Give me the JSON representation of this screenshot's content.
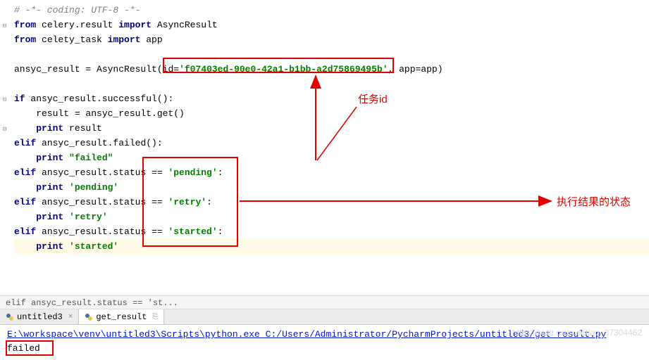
{
  "code": {
    "l1_comment": "# -*- coding: UTF-8 -*-",
    "l2_from": "from",
    "l2_mod": " celery.result ",
    "l2_import": "import",
    "l2_name": " AsyncResult",
    "l3_from": "from",
    "l3_mod": " celety_task ",
    "l3_import": "import",
    "l3_name": " app",
    "l5_pre": "ansyc_result = AsyncResult(",
    "l5_idkw": "id",
    "l5_eq": "=",
    "l5_str": "'f07403ed-90e0-42a1-b1bb-a2d75869495b'",
    "l5_mid": ", ",
    "l5_appkw": "app",
    "l5_post": "=app)",
    "l7_if": "if",
    "l7_rest": " ansyc_result.successful():",
    "l8_rest": "    result = ansyc_result.get()",
    "l9_print": "    print",
    "l9_rest": " result",
    "l10_elif": "elif",
    "l10_rest": " ansyc_result.failed():",
    "l11_print": "    print",
    "l11_str": " \"failed\"",
    "l12_elif": "elif",
    "l12_rest": " ansyc_result.status == ",
    "l12_str": "'pending'",
    "l12_colon": ":",
    "l13_print": "    print",
    "l13_str": " 'pending'",
    "l14_elif": "elif",
    "l14_rest": " ansyc_result.status == ",
    "l14_str": "'retry'",
    "l14_colon": ":",
    "l15_print": "    print",
    "l15_str": " 'retry'",
    "l16_elif": "elif",
    "l16_rest": " ansyc_result.status == ",
    "l16_str": "'started'",
    "l16_colon": ":",
    "l17_print": "    print",
    "l17_str": " 'started'"
  },
  "annotations": {
    "task_id_label": "任务id",
    "status_label": "执行结果的状态"
  },
  "breadcrumb": {
    "text": "elif ansyc_result.status == 'st..."
  },
  "tabs": {
    "t1_label": "untitled3",
    "t2_label": "get_result"
  },
  "console": {
    "cmd": "E:\\workspace\\venv\\untitled3\\Scripts\\python.exe C:/Users/Administrator/PycharmProjects/untitled3/get_result.py",
    "out": "failed"
  },
  "watermark": "https://blog.csdn.net/qq_37304462"
}
